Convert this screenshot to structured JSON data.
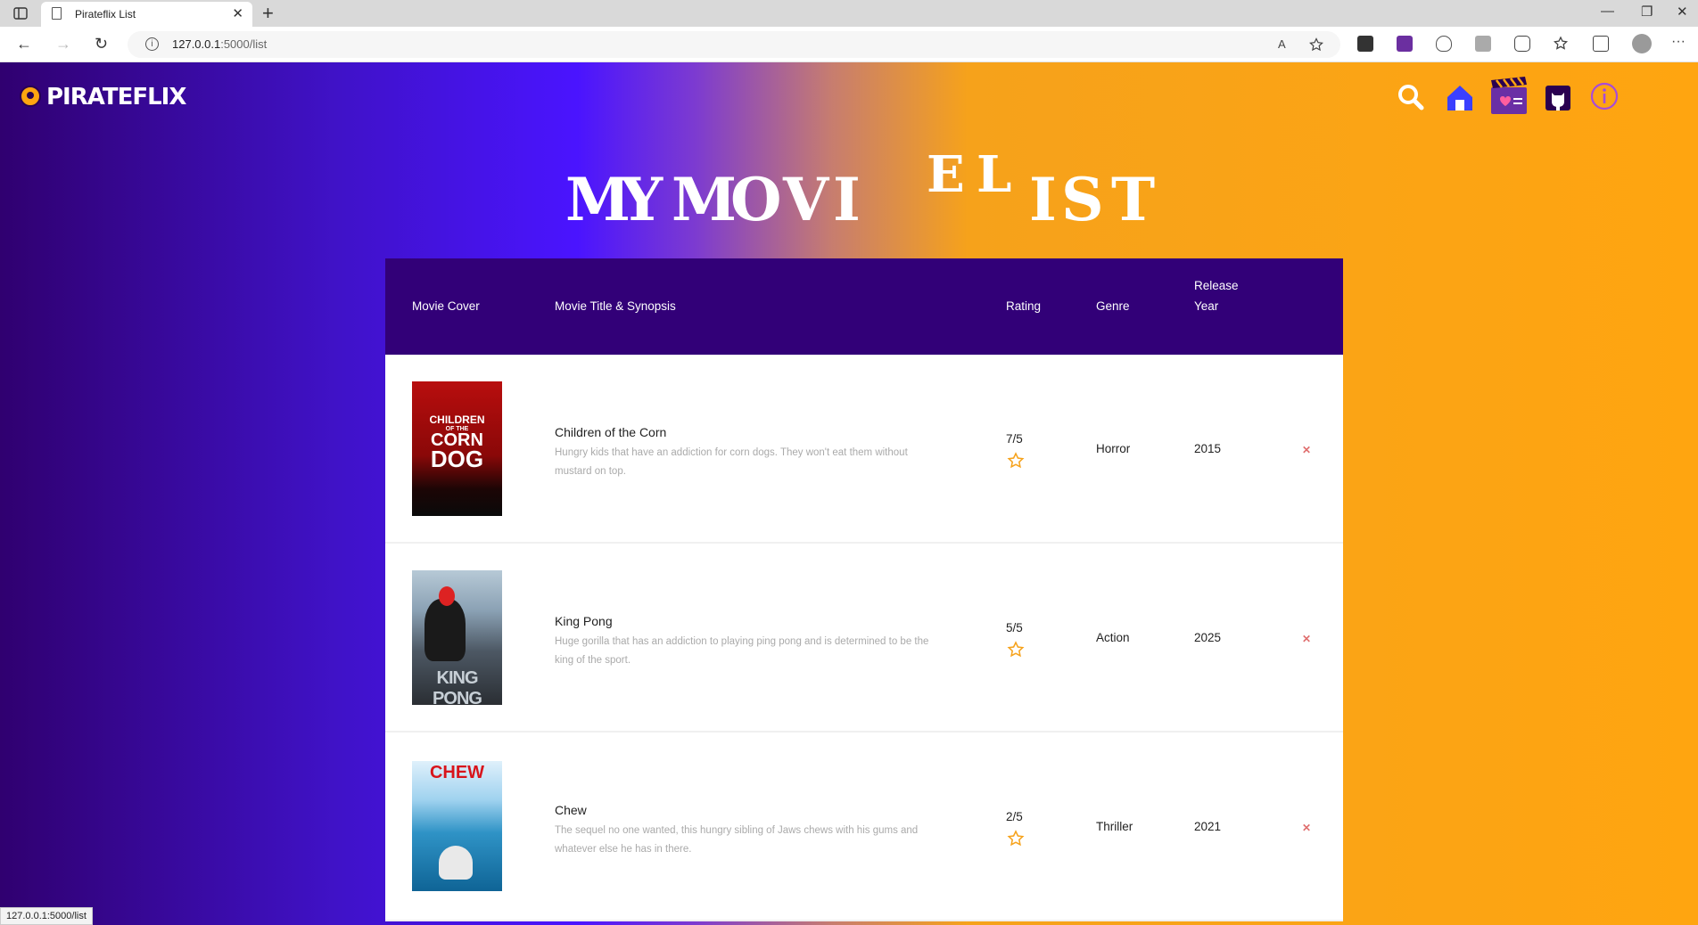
{
  "browser": {
    "tab_title": "Pirateflix List",
    "tab_close": "✕",
    "new_tab": "+",
    "url_host": "127.0.0.1",
    "url_path": ":5000/list",
    "back": "←",
    "forward": "→",
    "reload": "↻",
    "read_aloud": "A",
    "minimize": "—",
    "restore": "❐",
    "close": "✕",
    "more": "···"
  },
  "site": {
    "logo_text": "PIRATEFLIX",
    "hero_letters": [
      "M",
      "Y",
      "M",
      "O",
      "V",
      "I",
      "E",
      "L",
      "I",
      "S",
      "T"
    ],
    "nav": [
      "search-icon",
      "home-icon",
      "movie-clapper-icon",
      "github-icon",
      "info-icon"
    ]
  },
  "table": {
    "headers": {
      "cover": "Movie Cover",
      "title": "Movie Title & Synopsis",
      "rating": "Rating",
      "genre": "Genre",
      "year_line1": "Release",
      "year_line2": "Year"
    },
    "rows": [
      {
        "title": "Children of the Corn",
        "synopsis": "Hungry kids that have an addiction for corn dogs. They won't eat them without mustard on top.",
        "rating": "7/5",
        "genre": "Horror",
        "year": "2015",
        "cover_text": [
          "CHILDREN",
          "OF THE",
          "CORN",
          "DOG"
        ],
        "delete": "✕"
      },
      {
        "title": "King Pong",
        "synopsis": "Huge gorilla that has an addiction to playing ping pong and is determined to be the king of the sport.",
        "rating": "5/5",
        "genre": "Action",
        "year": "2025",
        "cover_text": [
          "KING PONG"
        ],
        "delete": "✕"
      },
      {
        "title": "Chew",
        "synopsis": "The sequel no one wanted, this hungry sibling of Jaws chews with his gums and whatever else he has in there.",
        "rating": "2/5",
        "genre": "Thriller",
        "year": "2021",
        "cover_text": [
          "CHEW"
        ],
        "delete": "✕"
      }
    ]
  },
  "status_bar": "127.0.0.1:5000/list",
  "colors": {
    "header_purple": "#320078",
    "accent_orange": "#ffa510",
    "delete_red": "#e06f6f"
  }
}
